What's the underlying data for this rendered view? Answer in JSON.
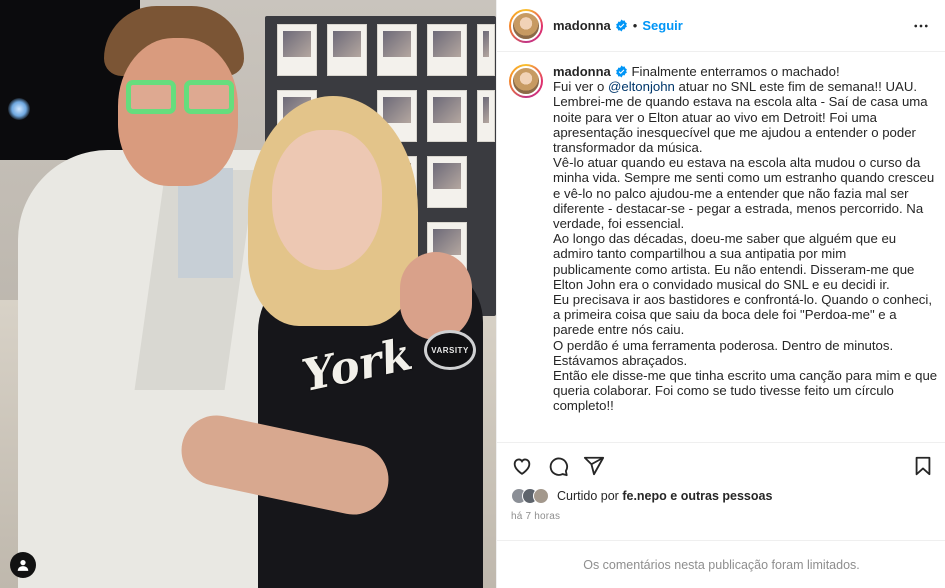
{
  "post": {
    "username": "madonna",
    "separator": "•",
    "follow_label": "Seguir",
    "caption_lines": [
      "Finalmente enterramos o machado!",
      "Fui ver o |@eltonjohn| atuar no SNL este fim de semana!! UAU.",
      "Lembrei-me de quando estava na escola alta - Saí de casa uma",
      "noite para ver o Elton atuar ao vivo em Detroit! Foi uma",
      "apresentação inesquecível que me ajudou a entender o poder",
      "transformador da música.",
      "Vê-lo atuar quando eu estava na escola alta mudou o curso da",
      "minha vida. Sempre me senti como um estranho quando cresceu",
      "e vê-lo no palco ajudou-me a entender que não fazia mal ser",
      "diferente - destacar-se - pegar a estrada, menos percorrido. Na",
      "verdade, foi essencial.",
      "Ao longo das décadas, doeu-me saber que alguém que eu",
      "admiro tanto compartilhou a sua antipatia por mim",
      "publicamente como artista. Eu não entendi. Disseram-me que",
      "Elton John era o convidado musical do SNL e eu decidi ir.",
      "Eu precisava ir aos bastidores e confrontá-lo. Quando o conheci,",
      "a primeira coisa que saiu da boca dele foi \"Perdoa-me\" e a",
      "parede entre nós caiu.",
      "O perdão é uma ferramenta poderosa. Dentro de minutos.",
      "Estávamos abraçados.",
      "Então ele disse-me que tinha escrito uma canção para mim e que",
      "queria colaborar. Foi como se tudo tivesse feito um círculo",
      "completo!!"
    ],
    "likes": {
      "prefix": "Curtido por",
      "user": "fe.nepo",
      "suffix": "e outras pessoas"
    },
    "time_ago": "há 7 horas",
    "comments_limited": "Os comentários nesta publicação foram limitados.",
    "photo": {
      "jacket_text": "York",
      "patch_text": "VARSITY"
    },
    "colors": {
      "follow": "#0095f6",
      "mention": "#00376b",
      "muted": "#8e8e8e",
      "glasses": "#66dd7d"
    },
    "icons": [
      "verified-badge-icon",
      "more-options-icon",
      "heart-icon",
      "comment-icon",
      "share-icon",
      "bookmark-icon",
      "user-tag-icon"
    ]
  }
}
